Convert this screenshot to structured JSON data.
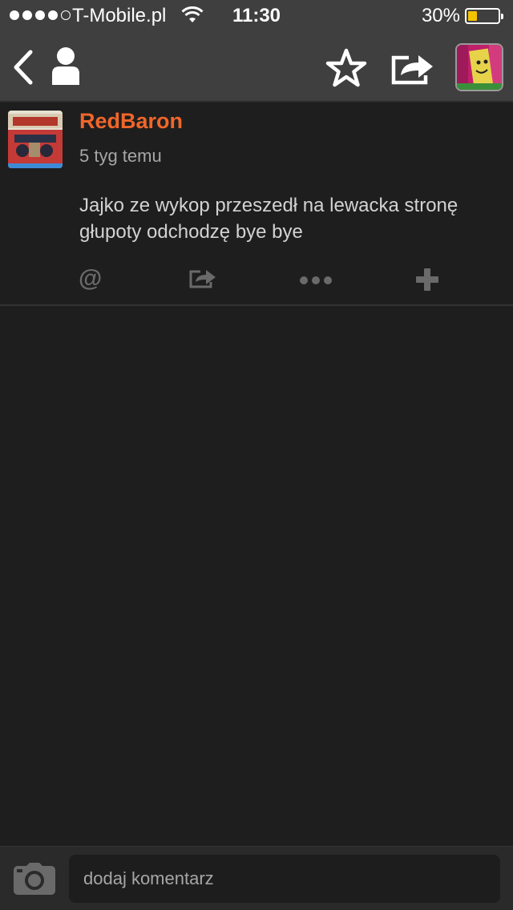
{
  "status_bar": {
    "carrier": "T-Mobile.pl",
    "time": "11:30",
    "battery_percent_label": "30%",
    "battery_level": 0.3,
    "signal_bars": 4,
    "signal_max": 5
  },
  "nav": {
    "icons": [
      "back-icon",
      "profile-icon",
      "star-icon",
      "share-icon",
      "user-avatar"
    ]
  },
  "post": {
    "author": "RedBaron",
    "time_ago": "5 tyg temu",
    "text": "Jajko ze wykop przeszedł na lewacka stronę głupoty odchodzę bye bye",
    "actions": {
      "mention_label": "@"
    }
  },
  "comment_bar": {
    "placeholder": "dodaj komentarz"
  },
  "colors": {
    "background": "#1e1e1e",
    "bars": "#3f3f3f",
    "author_accent": "#f0662a",
    "battery": "#f4c300"
  }
}
